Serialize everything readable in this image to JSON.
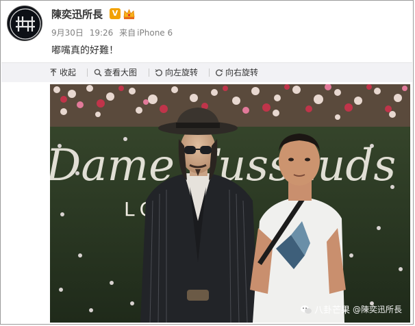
{
  "post": {
    "username": "陳奕迅所長",
    "verified_badge": "V",
    "date": "9月30日",
    "time": "19:26",
    "source_prefix": "来自",
    "source": "iPhone 6",
    "text": "嘟嘴真的好難！"
  },
  "toolbar": {
    "collapse_label": "收起",
    "view_large_label": "查看大图",
    "rotate_left_label": "向左旋转",
    "rotate_right_label": "向右旋转"
  },
  "photo": {
    "sign_text": "Dame Tussauds",
    "sign_sub": "LO",
    "watermark_brand": "八卦芒果",
    "watermark_handle": "@陳奕迅所長"
  },
  "colors": {
    "vip_badge": "#f2a200",
    "toolbar_bg": "#f2f2f5",
    "text_main": "#333333",
    "text_meta": "#808080"
  },
  "icons": [
    "avatar-logo-icon",
    "vip-badge-icon",
    "crown-icon",
    "collapse-icon",
    "magnifier-icon",
    "rotate-left-icon",
    "rotate-right-icon",
    "wechat-icon"
  ]
}
